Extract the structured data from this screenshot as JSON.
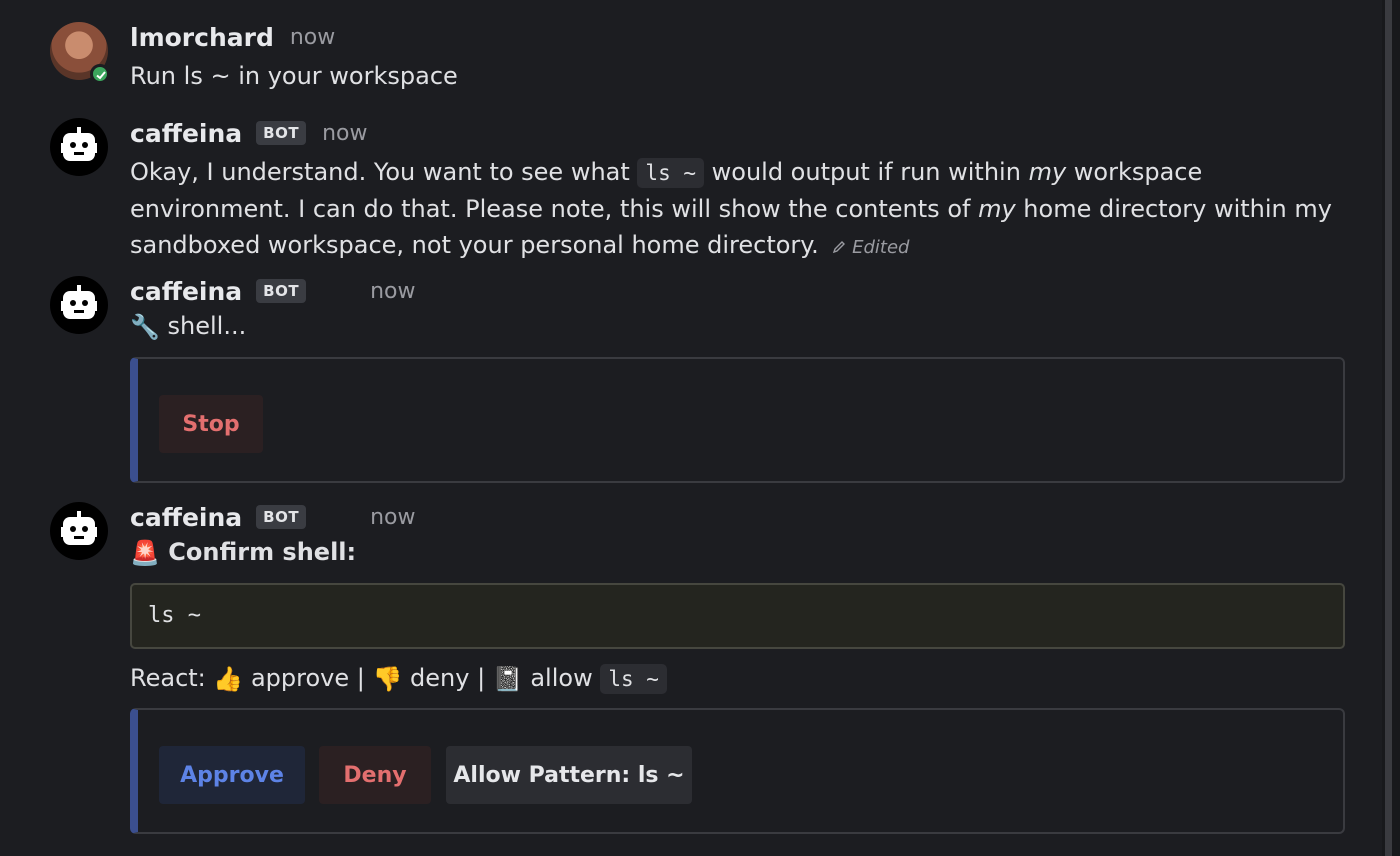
{
  "messages": {
    "m1": {
      "author": "lmorchard",
      "time": "now",
      "text": "Run ls ~ in your workspace"
    },
    "m2": {
      "author": "caffeina",
      "badge": "BOT",
      "time": "now",
      "t1": "Okay, I understand. You want to see what ",
      "code": "ls ~",
      "t2": " would output if run within ",
      "em1": "my",
      "t3": " workspace environment. I can do that. Please note, this will show the contents of ",
      "em2": "my",
      "t4": " home directory within my sandboxed workspace, not your personal home directory.",
      "edited": "Edited"
    },
    "m3": {
      "author": "caffeina",
      "badge": "BOT",
      "time": "now",
      "emoji": "🔧",
      "text": "shell...",
      "stop_label": "Stop"
    },
    "m4": {
      "author": "caffeina",
      "badge": "BOT",
      "time": "now",
      "emoji": "🚨",
      "heading": "Confirm shell:",
      "code_block": "ls ~",
      "react_label": "React:",
      "thumbs_up": "👍",
      "approve_word": "approve",
      "sep": "|",
      "thumbs_down": "👎",
      "deny_word": "deny",
      "notebook": "📓",
      "allow_word": "allow",
      "allow_code": "ls ~",
      "approve_label": "Approve",
      "deny_label": "Deny",
      "allow_pattern_label": "Allow Pattern: ls ~"
    }
  },
  "colors": {
    "background": "#1c1d21",
    "accent_bar": "#3b4f8f",
    "approve": "#5d83e6",
    "danger": "#e36f6f",
    "online": "#3ba55d"
  },
  "icons": {
    "user_avatar": "photo-avatar",
    "bot_avatar": "robot-icon",
    "status": "check-icon",
    "edit": "pencil-icon"
  }
}
